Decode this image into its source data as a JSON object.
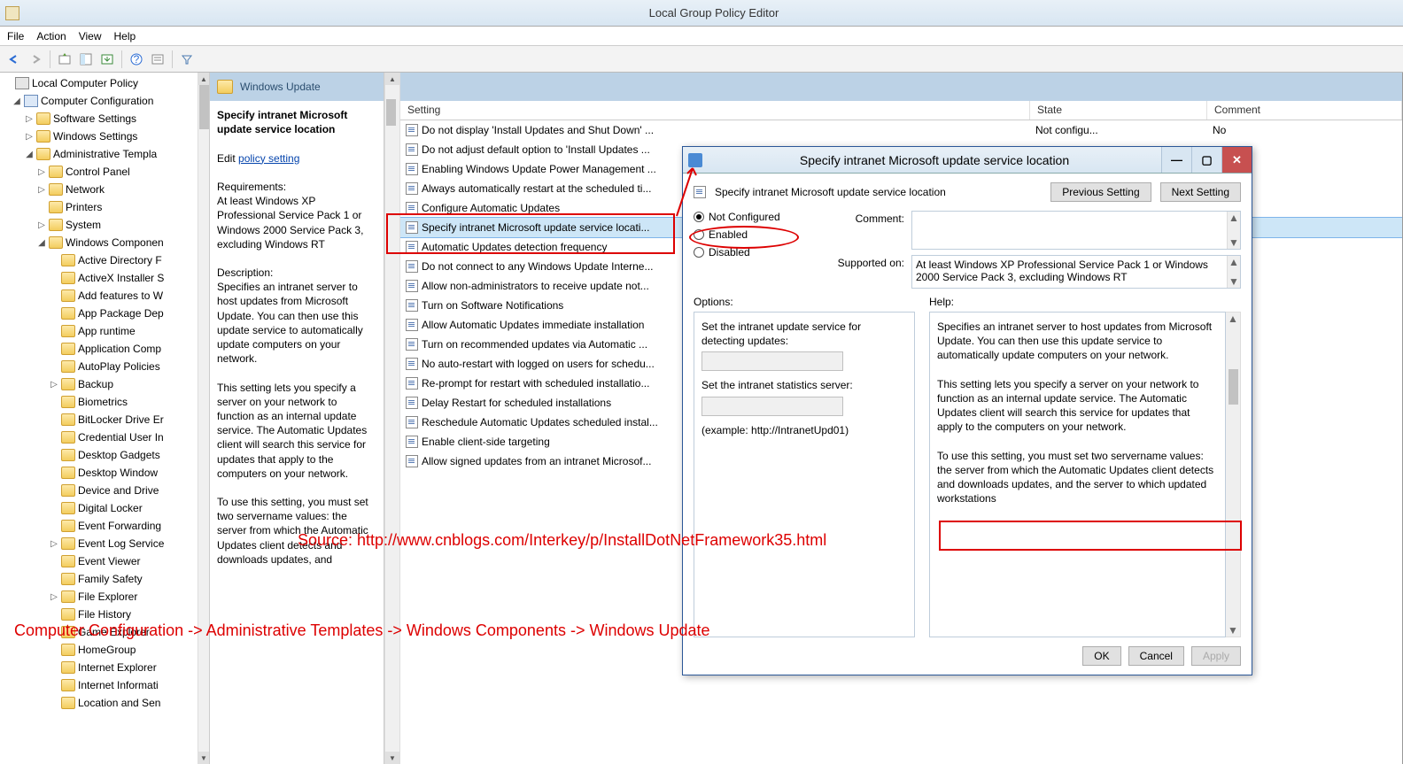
{
  "window": {
    "title": "Local Group Policy Editor"
  },
  "menu": {
    "file": "File",
    "action": "Action",
    "view": "View",
    "help": "Help"
  },
  "tree": {
    "root": "Local Computer Policy",
    "cc": "Computer Configuration",
    "ss": "Software Settings",
    "ws": "Windows Settings",
    "at": "Administrative Templa",
    "cp": "Control Panel",
    "net": "Network",
    "prn": "Printers",
    "sys": "System",
    "wc": "Windows Componen",
    "items": [
      "Active Directory F",
      "ActiveX Installer S",
      "Add features to W",
      "App Package Dep",
      "App runtime",
      "Application Comp",
      "AutoPlay Policies",
      "Backup",
      "Biometrics",
      "BitLocker Drive Er",
      "Credential User In",
      "Desktop Gadgets",
      "Desktop Window",
      "Device and Drive",
      "Digital Locker",
      "Event Forwarding",
      "Event Log Service",
      "Event Viewer",
      "Family Safety",
      "File Explorer",
      "File History",
      "Game Explorer",
      "HomeGroup",
      "Internet Explorer",
      "Internet Informati",
      "Location and Sen"
    ]
  },
  "content": {
    "header": "Windows Update",
    "desc_title": "Specify intranet Microsoft update service location",
    "edit": "Edit",
    "policy_link": "policy setting",
    "req_h": "Requirements:",
    "req_t": "At least Windows XP Professional Service Pack 1 or Windows 2000 Service Pack 3, excluding Windows RT",
    "desc_h": "Description:",
    "desc_t1": "Specifies an intranet server to host updates from Microsoft Update. You can then use this update service to automatically update computers on your network.",
    "desc_t2": "This setting lets you specify a server on your network to function as an internal update service. The Automatic Updates client will search this service for updates that apply to the computers on your network.",
    "desc_t3": "To use this setting, you must set two servername values: the server from which the Automatic Updates client detects and downloads updates, and",
    "cols": {
      "setting": "Setting",
      "state": "State",
      "comment": "Comment"
    },
    "rows": [
      {
        "s": "Do not display 'Install Updates and Shut Down' ...",
        "st": "Not configu...",
        "c": "No"
      },
      {
        "s": "Do not adjust default option to 'Install Updates ...",
        "st": "",
        "c": ""
      },
      {
        "s": "Enabling Windows Update Power Management ...",
        "st": "",
        "c": ""
      },
      {
        "s": "Always automatically restart at the scheduled ti...",
        "st": "",
        "c": ""
      },
      {
        "s": "Configure Automatic Updates",
        "st": "",
        "c": ""
      },
      {
        "s": "Specify intranet Microsoft update service locati...",
        "st": "",
        "c": ""
      },
      {
        "s": "Automatic Updates detection frequency",
        "st": "",
        "c": ""
      },
      {
        "s": "Do not connect to any Windows Update Interne...",
        "st": "",
        "c": ""
      },
      {
        "s": "Allow non-administrators to receive update not...",
        "st": "",
        "c": ""
      },
      {
        "s": "Turn on Software Notifications",
        "st": "",
        "c": ""
      },
      {
        "s": "Allow Automatic Updates immediate installation",
        "st": "",
        "c": ""
      },
      {
        "s": "Turn on recommended updates via Automatic ...",
        "st": "",
        "c": ""
      },
      {
        "s": "No auto-restart with logged on users for schedu...",
        "st": "",
        "c": ""
      },
      {
        "s": "Re-prompt for restart with scheduled installatio...",
        "st": "",
        "c": ""
      },
      {
        "s": "Delay Restart for scheduled installations",
        "st": "",
        "c": ""
      },
      {
        "s": "Reschedule Automatic Updates scheduled instal...",
        "st": "",
        "c": ""
      },
      {
        "s": "Enable client-side targeting",
        "st": "",
        "c": ""
      },
      {
        "s": "Allow signed updates from an intranet Microsof...",
        "st": "",
        "c": ""
      }
    ]
  },
  "dialog": {
    "title": "Specify intranet Microsoft update service location",
    "heading": "Specify intranet Microsoft update service location",
    "prev": "Previous Setting",
    "next": "Next Setting",
    "nc": "Not Configured",
    "en": "Enabled",
    "dis": "Disabled",
    "comment": "Comment:",
    "supported": "Supported on:",
    "supported_t": "At least Windows XP Professional Service Pack 1 or Windows 2000 Service Pack 3, excluding Windows RT",
    "options": "Options:",
    "help": "Help:",
    "opt1": "Set the intranet update service for detecting updates:",
    "opt2": "Set the intranet statistics server:",
    "example": "(example: http://IntranetUpd01)",
    "help_t1": "Specifies an intranet server to host updates from Microsoft Update. You can then use this update service to automatically update computers on your network.",
    "help_t2": "This setting lets you specify a server on your network to function as an internal update service. The Automatic Updates client will search this service for updates that apply to the computers on your network.",
    "help_t3": "To use this setting, you must set two servername values: the server from which the Automatic Updates client detects and downloads updates, and the server to which updated workstations",
    "ok": "OK",
    "cancel": "Cancel",
    "apply": "Apply"
  },
  "annotations": {
    "source": "Source: http://www.cnblogs.com/Interkey/p/InstallDotNetFramework35.html",
    "path": "Computer Configuration -> Administrative Templates -> Windows Components -> Windows Update"
  }
}
